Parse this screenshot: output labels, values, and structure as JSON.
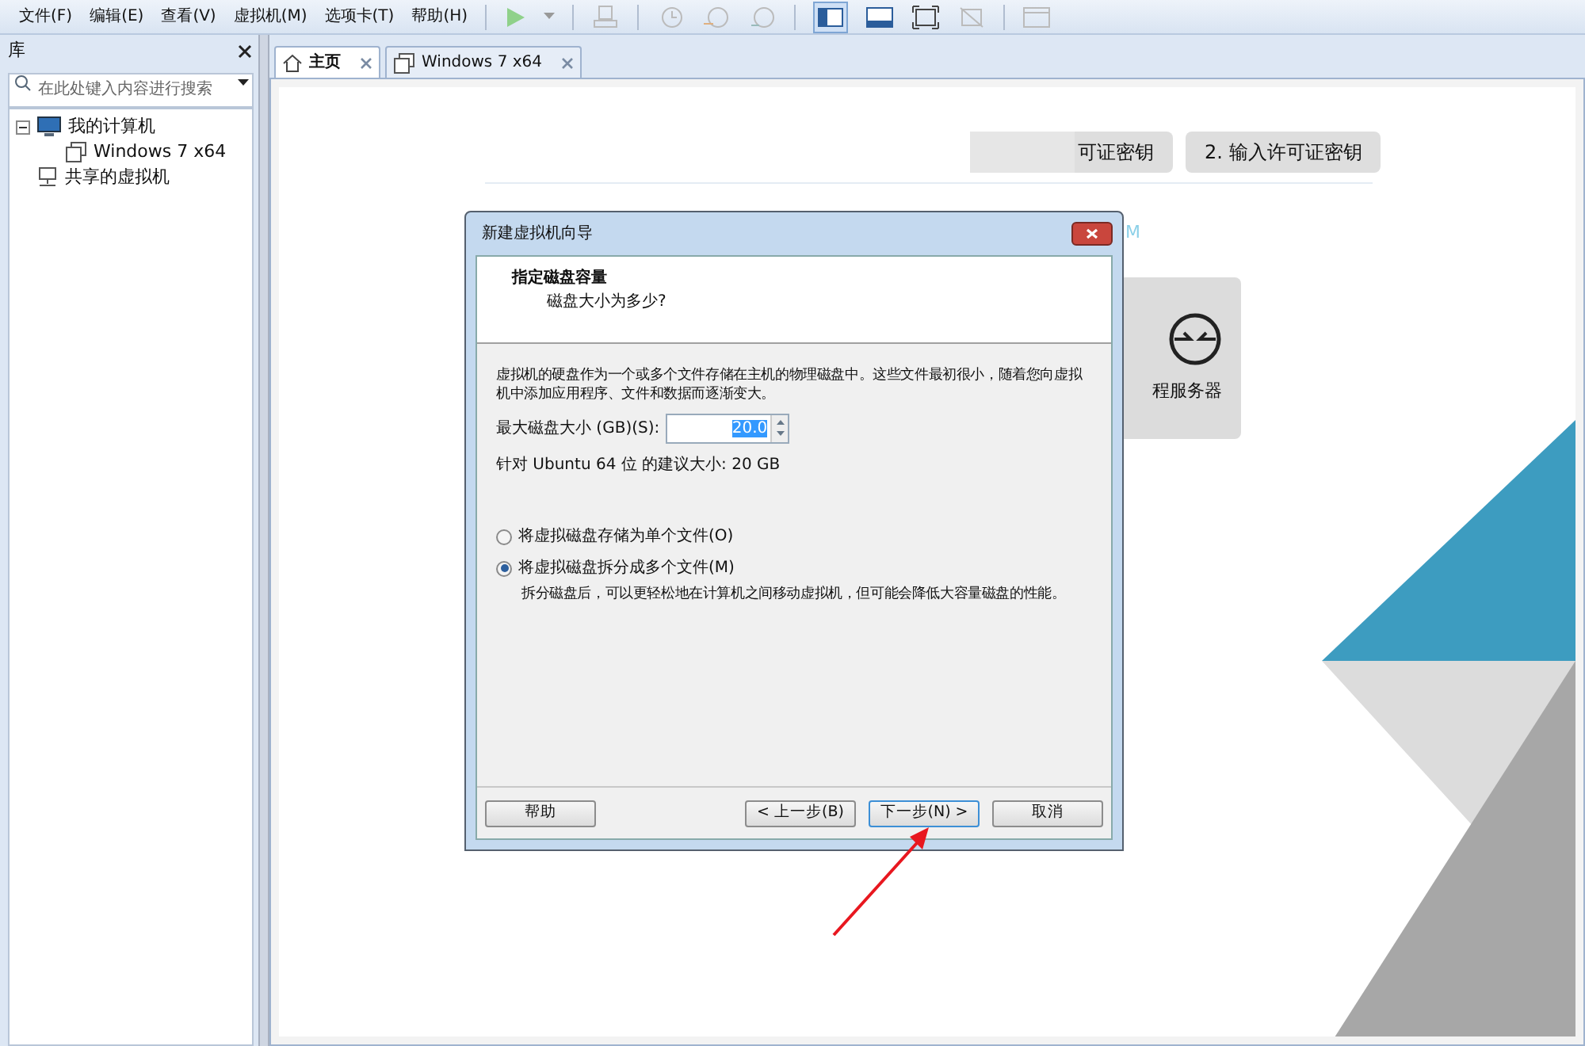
{
  "menu": [
    "文件(F)",
    "编辑(E)",
    "查看(V)",
    "虚拟机(M)",
    "选项卡(T)",
    "帮助(H)"
  ],
  "library": {
    "title": "库",
    "search": {
      "placeholder": "在此处键入内容进行搜索"
    },
    "tree": [
      {
        "label": "我的计算机",
        "kind": "computer",
        "expanded": true,
        "children": [
          {
            "label": "Windows 7 x64",
            "kind": "vm"
          }
        ]
      },
      {
        "label": "共享的虚拟机",
        "kind": "shared"
      }
    ]
  },
  "tabs": [
    {
      "label": "主页",
      "kind": "home",
      "selected": true
    },
    {
      "label": "Windows 7 x64",
      "kind": "vm",
      "selected": false
    }
  ],
  "home": {
    "license_buttons": [
      "可证密钥",
      "2. 输入许可证密钥"
    ],
    "fragment": "M",
    "tile": "程服务器"
  },
  "dialog": {
    "title": "新建虚拟机向导",
    "heading": "指定磁盘容量",
    "subheading": "磁盘大小为多少?",
    "description": "虚拟机的硬盘作为一个或多个文件存储在主机的物理磁盘中。这些文件最初很小，随着您向虚拟机中添加应用程序、文件和数据而逐渐变大。",
    "size_label": "最大磁盘大小 (GB)(S):",
    "size_value": "20.0",
    "recommendation": "针对 Ubuntu 64 位 的建议大小: 20 GB",
    "options": [
      {
        "label": "将虚拟磁盘存储为单个文件(O)",
        "selected": false
      },
      {
        "label": "将虚拟磁盘拆分成多个文件(M)",
        "selected": true
      }
    ],
    "option_note": "拆分磁盘后，可以更轻松地在计算机之间移动虚拟机，但可能会降低大容量磁盘的性能。",
    "buttons": [
      {
        "label": "帮助",
        "focused": false
      },
      {
        "label": "< 上一步(B)",
        "focused": false
      },
      {
        "label": "下一步(N) >",
        "focused": true
      },
      {
        "label": "取消",
        "focused": false
      }
    ]
  }
}
